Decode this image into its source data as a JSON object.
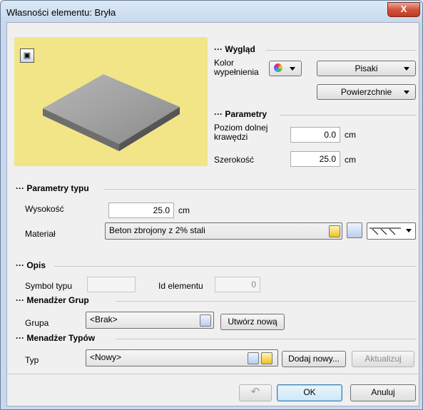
{
  "window": {
    "title": "Własności elementu: Bryła",
    "close_symbol": "X"
  },
  "appearance": {
    "section": "Wygląd",
    "fill_color_label": "Kolor wypełnienia",
    "pens_button": "Pisaki",
    "surfaces_button": "Powierzchnie"
  },
  "parameters": {
    "section": "Parametry",
    "lower_edge_label": "Poziom dolnej krawędzi",
    "lower_edge_value": "0.0",
    "lower_edge_unit": "cm",
    "width_label": "Szerokość",
    "width_value": "25.0",
    "width_unit": "cm"
  },
  "type_params": {
    "section": "Parametry typu",
    "height_label": "Wysokość",
    "height_value": "25.0",
    "height_unit": "cm",
    "material_label": "Materiał",
    "material_value": "Beton zbrojony z 2% stali"
  },
  "description": {
    "section": "Opis",
    "type_symbol_label": "Symbol typu",
    "type_symbol_value": "",
    "element_id_label": "Id elementu",
    "element_id_value": "0"
  },
  "group_manager": {
    "section": "Menadżer Grup",
    "group_label": "Grupa",
    "group_value": "<Brak>",
    "create_new_button": "Utwórz nową"
  },
  "type_manager": {
    "section": "Menadżer Typów",
    "type_label": "Typ",
    "type_value": "<Nowy>",
    "add_new_button": "Dodaj nowy...",
    "update_button": "Aktualizuj"
  },
  "footer": {
    "ok_button": "OK",
    "cancel_button": "Anuluj"
  },
  "colors": {
    "preview_bg": "#f1e587",
    "accent_border": "#3c7fb1",
    "close_red": "#c0391f"
  }
}
